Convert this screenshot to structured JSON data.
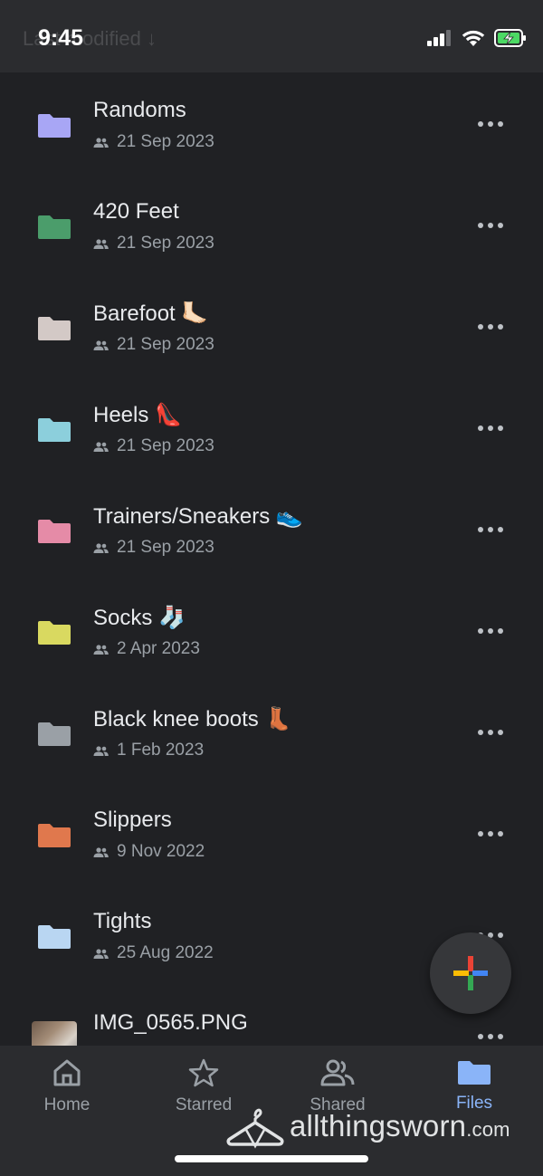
{
  "status": {
    "time": "9:45",
    "header_ghost": "Last modified ↓",
    "icons": [
      "signal-icon",
      "wifi-icon",
      "battery-charging-icon"
    ]
  },
  "colors": {
    "background": "#202124",
    "bar": "#2b2c2f",
    "active": "#8ab4f8",
    "meta": "#9aa0a6"
  },
  "files": [
    {
      "name": "Randoms",
      "date": "21 Sep 2023",
      "color": "#a8a6f5",
      "type": "folder"
    },
    {
      "name": "420 Feet",
      "date": "21 Sep 2023",
      "color": "#4b9d6b",
      "type": "folder"
    },
    {
      "name": "Barefoot 🦶🏻",
      "date": "21 Sep 2023",
      "color": "#d3c9c6",
      "type": "folder"
    },
    {
      "name": "Heels 👠",
      "date": "21 Sep 2023",
      "color": "#8ccfdc",
      "type": "folder"
    },
    {
      "name": "Trainers/Sneakers 👟",
      "date": "21 Sep 2023",
      "color": "#e58ba7",
      "type": "folder"
    },
    {
      "name": "Socks 🧦",
      "date": "2 Apr 2023",
      "color": "#d9d960",
      "type": "folder"
    },
    {
      "name": "Black knee boots 👢",
      "date": "1 Feb 2023",
      "color": "#9aa0a6",
      "type": "folder"
    },
    {
      "name": "Slippers",
      "date": "9 Nov 2022",
      "color": "#e0784d",
      "type": "folder"
    },
    {
      "name": "Tights",
      "date": "25 Aug 2022",
      "color": "#b9d6f2",
      "type": "folder"
    },
    {
      "name": "IMG_0565.PNG",
      "date": "",
      "color": "",
      "type": "image"
    }
  ],
  "fab": {
    "icon": "plus-icon"
  },
  "nav": [
    {
      "label": "Home",
      "icon": "home-icon",
      "active": false
    },
    {
      "label": "Starred",
      "icon": "star-icon",
      "active": false
    },
    {
      "label": "Shared",
      "icon": "people-icon",
      "active": false
    },
    {
      "label": "Files",
      "icon": "folder-icon",
      "active": true
    }
  ],
  "watermark": {
    "main": "allthingsworn",
    "suffix": ".com"
  }
}
